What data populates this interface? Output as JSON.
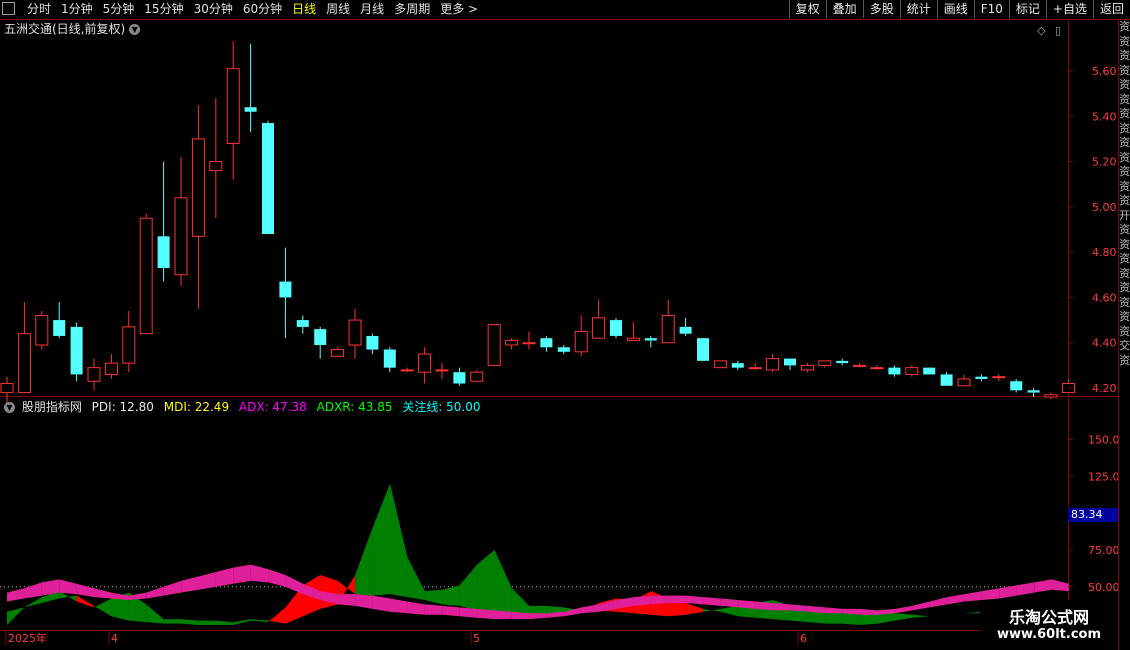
{
  "toolbar": {
    "tabs": [
      "分时",
      "1分钟",
      "5分钟",
      "15分钟",
      "30分钟",
      "60分钟",
      "日线",
      "周线",
      "月线",
      "多周期",
      "更多 >"
    ],
    "active_tab": "日线",
    "right_buttons": [
      "复权",
      "叠加",
      "多股",
      "统计",
      "画线",
      "F10",
      "标记",
      "+自选",
      "返回"
    ]
  },
  "main_chart": {
    "title": "五洲交通(日线,前复权)",
    "y_ticks": [
      "5.60",
      "5.40",
      "5.20",
      "5.00",
      "4.80",
      "4.60",
      "4.40",
      "4.20"
    ],
    "colors": {
      "up": "#ff3232",
      "down": "#54ffff",
      "grid": "#8b0000"
    }
  },
  "indicator": {
    "name": "股朋指标网",
    "pdi_label": "PDI: 12.80",
    "mdi_label": "MDI: 22.49",
    "adx_label": "ADX: 47.38",
    "adxr_label": "ADXR: 43.85",
    "focus_label": "关注线: 50.00",
    "y_ticks": [
      "150.00",
      "125.0",
      "100.0",
      "75.00",
      "50.00"
    ],
    "current_value": "83.34",
    "colors": {
      "pdi": "#e8e8e8",
      "mdi": "#ffff00",
      "adx": "#ff00ff",
      "adxr": "#00ff00",
      "focus": "#00ffff"
    }
  },
  "x_axis": {
    "labels": [
      "2025年",
      "4",
      "5",
      "6"
    ]
  },
  "side_labels": [
    "资",
    "资",
    "资",
    "资",
    "资",
    "资",
    "资",
    "资",
    "资",
    "资",
    "资",
    "资",
    "资",
    "开",
    "资",
    "资",
    "资",
    "资",
    "资",
    "资",
    "资",
    "资",
    "交",
    "资"
  ],
  "watermark": {
    "title": "乐淘公式网",
    "url": "www.60lt.com"
  },
  "chart_data": [
    {
      "type": "candlestick",
      "title": "五洲交通(日线,前复权)",
      "ylim": [
        4.05,
        5.75
      ],
      "candles": [
        {
          "o": 4.18,
          "c": 4.22,
          "h": 4.25,
          "l": 4.12
        },
        {
          "o": 4.18,
          "c": 4.44,
          "h": 4.58,
          "l": 4.18
        },
        {
          "o": 4.39,
          "c": 4.52,
          "h": 4.54,
          "l": 4.37
        },
        {
          "o": 4.5,
          "c": 4.43,
          "h": 4.58,
          "l": 4.42
        },
        {
          "o": 4.47,
          "c": 4.26,
          "h": 4.49,
          "l": 4.23
        },
        {
          "o": 4.23,
          "c": 4.29,
          "h": 4.33,
          "l": 4.19
        },
        {
          "o": 4.26,
          "c": 4.31,
          "h": 4.35,
          "l": 4.24
        },
        {
          "o": 4.31,
          "c": 4.47,
          "h": 4.54,
          "l": 4.27
        },
        {
          "o": 4.44,
          "c": 4.95,
          "h": 4.97,
          "l": 4.44
        },
        {
          "o": 4.87,
          "c": 4.73,
          "h": 5.2,
          "l": 4.67
        },
        {
          "o": 4.7,
          "c": 5.04,
          "h": 5.22,
          "l": 4.65
        },
        {
          "o": 4.87,
          "c": 5.3,
          "h": 5.45,
          "l": 4.55
        },
        {
          "o": 5.16,
          "c": 5.2,
          "h": 5.48,
          "l": 4.95
        },
        {
          "o": 5.28,
          "c": 5.61,
          "h": 5.73,
          "l": 5.12
        },
        {
          "o": 5.44,
          "c": 5.42,
          "h": 5.72,
          "l": 5.33
        },
        {
          "o": 5.37,
          "c": 4.88,
          "h": 5.38,
          "l": 4.88
        },
        {
          "o": 4.67,
          "c": 4.6,
          "h": 4.82,
          "l": 4.42
        },
        {
          "o": 4.5,
          "c": 4.47,
          "h": 4.52,
          "l": 4.44
        },
        {
          "o": 4.46,
          "c": 4.39,
          "h": 4.47,
          "l": 4.33
        },
        {
          "o": 4.34,
          "c": 4.37,
          "h": 4.38,
          "l": 4.34
        },
        {
          "o": 4.39,
          "c": 4.5,
          "h": 4.55,
          "l": 4.33
        },
        {
          "o": 4.43,
          "c": 4.37,
          "h": 4.44,
          "l": 4.35
        },
        {
          "o": 4.37,
          "c": 4.29,
          "h": 4.38,
          "l": 4.27
        },
        {
          "o": 4.28,
          "c": 4.28,
          "h": 4.29,
          "l": 4.27
        },
        {
          "o": 4.27,
          "c": 4.35,
          "h": 4.38,
          "l": 4.22
        },
        {
          "o": 4.28,
          "c": 4.28,
          "h": 4.31,
          "l": 4.24
        },
        {
          "o": 4.27,
          "c": 4.22,
          "h": 4.29,
          "l": 4.21
        },
        {
          "o": 4.23,
          "c": 4.27,
          "h": 4.28,
          "l": 4.23
        },
        {
          "o": 4.3,
          "c": 4.48,
          "h": 4.48,
          "l": 4.3
        },
        {
          "o": 4.39,
          "c": 4.41,
          "h": 4.42,
          "l": 4.37
        },
        {
          "o": 4.4,
          "c": 4.4,
          "h": 4.45,
          "l": 4.37
        },
        {
          "o": 4.42,
          "c": 4.38,
          "h": 4.43,
          "l": 4.36
        },
        {
          "o": 4.38,
          "c": 4.36,
          "h": 4.39,
          "l": 4.35
        },
        {
          "o": 4.36,
          "c": 4.45,
          "h": 4.52,
          "l": 4.34
        },
        {
          "o": 4.42,
          "c": 4.51,
          "h": 4.59,
          "l": 4.42
        },
        {
          "o": 4.5,
          "c": 4.43,
          "h": 4.51,
          "l": 4.42
        },
        {
          "o": 4.41,
          "c": 4.42,
          "h": 4.49,
          "l": 4.41
        },
        {
          "o": 4.42,
          "c": 4.41,
          "h": 4.43,
          "l": 4.38
        },
        {
          "o": 4.4,
          "c": 4.52,
          "h": 4.59,
          "l": 4.4
        },
        {
          "o": 4.47,
          "c": 4.44,
          "h": 4.51,
          "l": 4.43
        },
        {
          "o": 4.42,
          "c": 4.32,
          "h": 4.42,
          "l": 4.32
        },
        {
          "o": 4.29,
          "c": 4.32,
          "h": 4.32,
          "l": 4.29
        },
        {
          "o": 4.31,
          "c": 4.29,
          "h": 4.32,
          "l": 4.28
        },
        {
          "o": 4.29,
          "c": 4.29,
          "h": 4.31,
          "l": 4.28
        },
        {
          "o": 4.28,
          "c": 4.33,
          "h": 4.35,
          "l": 4.27
        },
        {
          "o": 4.33,
          "c": 4.3,
          "h": 4.33,
          "l": 4.28
        },
        {
          "o": 4.28,
          "c": 4.3,
          "h": 4.31,
          "l": 4.27
        },
        {
          "o": 4.3,
          "c": 4.32,
          "h": 4.32,
          "l": 4.29
        },
        {
          "o": 4.32,
          "c": 4.31,
          "h": 4.33,
          "l": 4.3
        },
        {
          "o": 4.3,
          "c": 4.3,
          "h": 4.31,
          "l": 4.29
        },
        {
          "o": 4.29,
          "c": 4.29,
          "h": 4.3,
          "l": 4.28
        },
        {
          "o": 4.29,
          "c": 4.26,
          "h": 4.3,
          "l": 4.25
        },
        {
          "o": 4.26,
          "c": 4.29,
          "h": 4.3,
          "l": 4.25
        },
        {
          "o": 4.29,
          "c": 4.26,
          "h": 4.29,
          "l": 4.26
        },
        {
          "o": 4.26,
          "c": 4.21,
          "h": 4.27,
          "l": 4.21
        },
        {
          "o": 4.21,
          "c": 4.24,
          "h": 4.26,
          "l": 4.21
        },
        {
          "o": 4.25,
          "c": 4.24,
          "h": 4.26,
          "l": 4.23
        },
        {
          "o": 4.25,
          "c": 4.25,
          "h": 4.26,
          "l": 4.23
        },
        {
          "o": 4.23,
          "c": 4.19,
          "h": 4.24,
          "l": 4.18
        },
        {
          "o": 4.19,
          "c": 4.18,
          "h": 4.2,
          "l": 4.16
        },
        {
          "o": 4.16,
          "c": 4.17,
          "h": 4.18,
          "l": 4.15
        },
        {
          "o": 4.18,
          "c": 4.22,
          "h": 4.24,
          "l": 4.18
        }
      ]
    },
    {
      "type": "area",
      "title": "股朋指标网",
      "ylim": [
        22,
        170
      ],
      "focus_line": 50.0,
      "series": [
        {
          "name": "PDI",
          "values": [
            33,
            36,
            43,
            47,
            40,
            36,
            42,
            46,
            38,
            28,
            28,
            27,
            27,
            26,
            28,
            27,
            25,
            30,
            35,
            38,
            58,
            90,
            120,
            70,
            47,
            48,
            51,
            65,
            75,
            49,
            37,
            37,
            36,
            34,
            34,
            33,
            32,
            31,
            30,
            31,
            33,
            35,
            37,
            39,
            41,
            37,
            37,
            35,
            35,
            34,
            33,
            32,
            31,
            30,
            31,
            32,
            33,
            34,
            35,
            36,
            35,
            36
          ]
        },
        {
          "name": "MDI",
          "values": [
            24,
            36,
            39,
            42,
            44,
            37,
            30,
            27,
            26,
            25,
            25,
            24,
            24,
            24,
            27,
            26,
            36,
            51,
            58,
            54,
            45,
            44,
            45,
            43,
            41,
            38,
            37,
            34,
            33,
            30,
            30,
            30,
            31,
            34,
            39,
            42,
            41,
            47,
            42,
            39,
            35,
            33,
            30,
            29,
            28,
            27,
            26,
            25,
            25,
            24,
            25,
            27,
            29,
            30,
            31,
            32,
            32,
            31,
            31,
            33,
            34,
            37
          ]
        },
        {
          "name": "ADX",
          "values": [
            40,
            42,
            44,
            46,
            45,
            43,
            42,
            41,
            42,
            44,
            46,
            48,
            50,
            52,
            54,
            53,
            50,
            45,
            41,
            38,
            37,
            35,
            33,
            32,
            31,
            31,
            30,
            29,
            28,
            28,
            28,
            29,
            30,
            32,
            33,
            35,
            37,
            38,
            39,
            39,
            38,
            37,
            36,
            35,
            34,
            34,
            33,
            32,
            32,
            31,
            31,
            32,
            34,
            36,
            38,
            40,
            41,
            42,
            44,
            46,
            48,
            47
          ]
        },
        {
          "name": "ADXR",
          "values": [
            46,
            49,
            53,
            55,
            52,
            49,
            46,
            44,
            46,
            50,
            54,
            57,
            60,
            63,
            65,
            62,
            58,
            52,
            47,
            45,
            45,
            44,
            42,
            40,
            38,
            37,
            36,
            35,
            34,
            33,
            32,
            32,
            33,
            36,
            38,
            41,
            43,
            44,
            44,
            44,
            43,
            42,
            41,
            40,
            39,
            38,
            37,
            36,
            35,
            35,
            34,
            35,
            37,
            40,
            43,
            45,
            47,
            49,
            51,
            53,
            55,
            52
          ]
        }
      ]
    }
  ]
}
